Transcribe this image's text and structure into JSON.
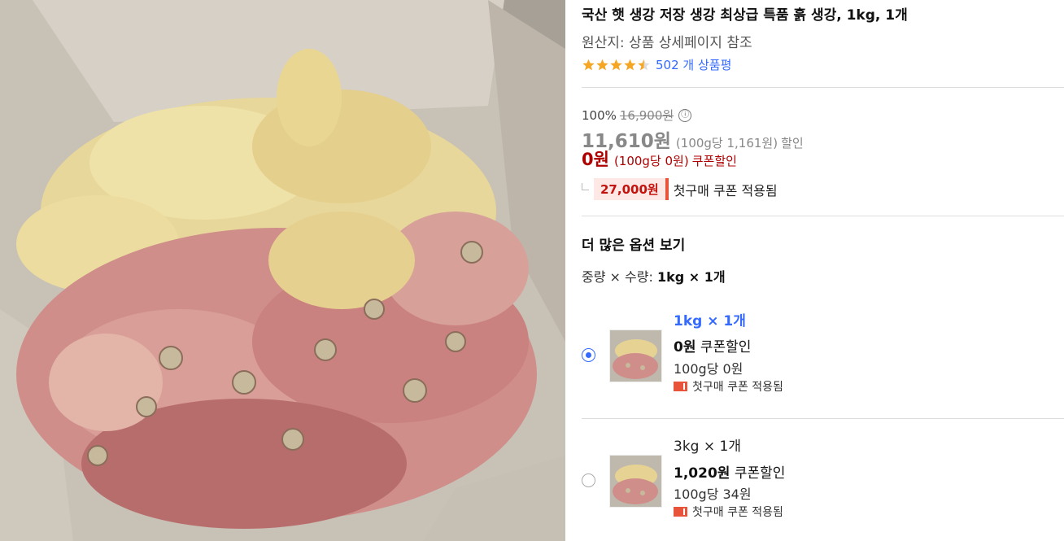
{
  "product": {
    "title": "국산 햇 생강 저장 생강 최상급 특품 흙 생강, 1kg, 1개",
    "origin": "원산지: 상품 상세페이지 참조",
    "rating_stars": 4.5,
    "review_count": "502 개 상품평"
  },
  "price": {
    "discount_rate": "100%",
    "original": "16,900원",
    "info_icon": "ⓘ",
    "sale": "11,610원",
    "sale_unit": "(100g당 1,161원)",
    "sale_tag": "할인",
    "coupon_price": "0원",
    "coupon_unit": "(100g당 0원)",
    "coupon_tag": "쿠폰할인",
    "first_purchase_amount": "27,000원",
    "first_purchase_label": "첫구매 쿠폰 적용됨"
  },
  "options": {
    "heading": "더 많은 옵션 보기",
    "qty_label": "중량 × 수량: ",
    "qty_value": "1kg × 1개",
    "items": [
      {
        "name": "1kg × 1개",
        "price": "0원",
        "tag": "쿠폰할인",
        "unit": "100g당 0원",
        "badge": "첫구매 쿠폰 적용됨",
        "selected": true
      },
      {
        "name": "3kg × 1개",
        "price": "1,020원",
        "tag": "쿠폰할인",
        "unit": "100g당 34원",
        "badge": "첫구매 쿠폰 적용됨",
        "selected": false
      }
    ]
  },
  "colors": {
    "accent": "#346aff",
    "coupon_red": "#ae0000",
    "star": "#f5a623"
  }
}
